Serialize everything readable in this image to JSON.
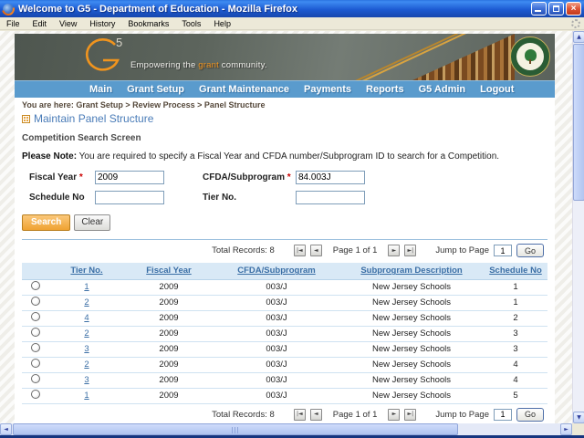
{
  "window": {
    "title": "Welcome to G5 - Department of Education - Mozilla Firefox",
    "menus": [
      "File",
      "Edit",
      "View",
      "History",
      "Bookmarks",
      "Tools",
      "Help"
    ],
    "close_glyph": "×"
  },
  "banner": {
    "logo_5": "5",
    "tagline_pre": "Empowering the ",
    "tagline_grant": "grant",
    "tagline_post": " community."
  },
  "nav": {
    "items": [
      "Main",
      "Grant Setup",
      "Grant Maintenance",
      "Payments",
      "Reports",
      "G5 Admin",
      "Logout"
    ]
  },
  "breadcrumb": {
    "prefix": "You are here:",
    "path": "Grant Setup > Review Process > Panel Structure"
  },
  "page": {
    "title": "Maintain Panel Structure"
  },
  "search": {
    "section_title": "Competition Search Screen",
    "note_label": "Please Note:",
    "note_text": " You are required to specify a Fiscal Year and CFDA number/Subprogram ID to search for a Competition.",
    "fields": {
      "fiscal_year": {
        "label": "Fiscal Year",
        "required": "*",
        "value": "2009"
      },
      "cfda": {
        "label": "CFDA/Subprogram",
        "required": "*",
        "value": "84.003J"
      },
      "schedule": {
        "label": "Schedule No",
        "value": ""
      },
      "tier": {
        "label": "Tier No.",
        "value": ""
      }
    },
    "buttons": {
      "search": "Search",
      "clear": "Clear"
    }
  },
  "pagination": {
    "total": "Total Records: 8",
    "page": "Page 1 of 1",
    "jump_label": "Jump to Page",
    "jump_value": "1",
    "go": "Go",
    "first_icon": "|◄",
    "prev_icon": "◄",
    "next_icon": "►",
    "last_icon": "►|"
  },
  "scrollbar": {
    "up_icon": "▲",
    "down_icon": "▼",
    "left_icon": "◄",
    "right_icon": "►"
  },
  "table": {
    "headers": [
      "Tier No.",
      "Fiscal Year",
      "CFDA/Subprogram",
      "Subprogram Description",
      "Schedule No"
    ],
    "rows": [
      {
        "tier": "1",
        "fiscal_year": "2009",
        "cfda": "003/J",
        "description": "New Jersey Schools",
        "schedule": "1"
      },
      {
        "tier": "2",
        "fiscal_year": "2009",
        "cfda": "003/J",
        "description": "New Jersey Schools",
        "schedule": "1"
      },
      {
        "tier": "4",
        "fiscal_year": "2009",
        "cfda": "003/J",
        "description": "New Jersey Schools",
        "schedule": "2"
      },
      {
        "tier": "2",
        "fiscal_year": "2009",
        "cfda": "003/J",
        "description": "New Jersey Schools",
        "schedule": "3"
      },
      {
        "tier": "3",
        "fiscal_year": "2009",
        "cfda": "003/J",
        "description": "New Jersey Schools",
        "schedule": "3"
      },
      {
        "tier": "2",
        "fiscal_year": "2009",
        "cfda": "003/J",
        "description": "New Jersey Schools",
        "schedule": "4"
      },
      {
        "tier": "3",
        "fiscal_year": "2009",
        "cfda": "003/J",
        "description": "New Jersey Schools",
        "schedule": "4"
      },
      {
        "tier": "1",
        "fiscal_year": "2009",
        "cfda": "003/J",
        "description": "New Jersey Schools",
        "schedule": "5"
      }
    ]
  },
  "colors": {
    "accent_orange": "#F0941E",
    "nav_blue": "#5A9BCD",
    "link_blue": "#3A6EA5",
    "table_header_bg": "#D9E9F6",
    "titlebar_blue": "#1D5BD2"
  }
}
